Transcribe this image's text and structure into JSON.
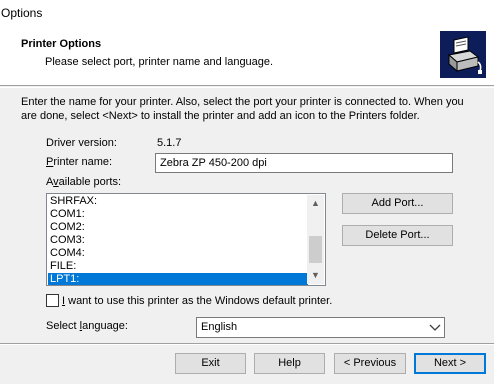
{
  "window": {
    "title": "Options"
  },
  "header": {
    "title": "Printer Options",
    "subtitle": "Please select port, printer name and language."
  },
  "intro_text": "Enter the name for your printer. Also, select the port your printer is connected to. When you are done, select <Next> to install the printer and add an icon to the Printers folder.",
  "driver": {
    "label": "Driver version:",
    "value": "5.1.7"
  },
  "printer_name": {
    "label_underlined": "P",
    "label_rest": "rinter name:",
    "value": "Zebra  ZP 450-200 dpi"
  },
  "ports": {
    "label_prefix": "A",
    "label_underlined": "v",
    "label_rest": "ailable ports:",
    "items": [
      "SHRFAX:",
      "COM1:",
      "COM2:",
      "COM3:",
      "COM4:",
      "FILE:",
      "LPT1:"
    ],
    "selected": "LPT1:",
    "scroll_position": 0.85
  },
  "buttons": {
    "add_port": "Add Port...",
    "delete_port": "Delete Port...",
    "exit": "Exit",
    "help": "Help",
    "previous": "< Previous",
    "next": "Next >"
  },
  "default_checkbox": {
    "label_underlined": "I",
    "label_rest": " want to use this printer as the Windows default printer.",
    "checked": false
  },
  "language": {
    "label_prefix": "Select ",
    "label_underlined": "l",
    "label_rest": "anguage:",
    "value": "English"
  },
  "icons": {
    "header": "printer-setup-icon",
    "scroll_up": "scroll-up-arrow-icon",
    "scroll_down": "scroll-down-arrow-icon",
    "combo": "chevron-down-icon"
  },
  "colors": {
    "selection": "#0078d7",
    "header_icon_bg": "#0c1d5a",
    "dialog_bg": "#f0f0f0"
  }
}
